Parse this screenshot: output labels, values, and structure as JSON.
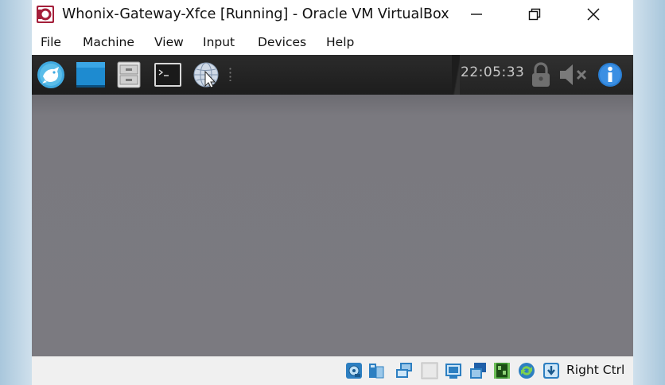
{
  "window": {
    "title": "Whonix-Gateway-Xfce [Running] - Oracle VM VirtualBox"
  },
  "menu": {
    "items": [
      "File",
      "Machine",
      "View",
      "Input",
      "Devices",
      "Help"
    ]
  },
  "guest_panel": {
    "launchers": [
      "whonix-logo-icon",
      "desktop-icon",
      "file-manager-icon",
      "terminal-icon",
      "browser-icon"
    ],
    "clock": "22:05:33",
    "tray": [
      "lock-icon",
      "volume-muted-icon",
      "info-icon"
    ]
  },
  "statusbar": {
    "icons": [
      "hard-disk-icon",
      "optical-drive-icon",
      "network-icon",
      "usb-icon",
      "shared-folders-icon",
      "display-icon",
      "recording-icon",
      "cpu-icon",
      "mouse-integration-icon",
      "keyboard-icon"
    ],
    "host_key": "Right Ctrl"
  },
  "colors": {
    "panel_bg": "#1d1d1d",
    "guest_screen": "#7b7a80",
    "info_blue": "#2a7fd4",
    "app_icon_red": "#c0392b"
  }
}
